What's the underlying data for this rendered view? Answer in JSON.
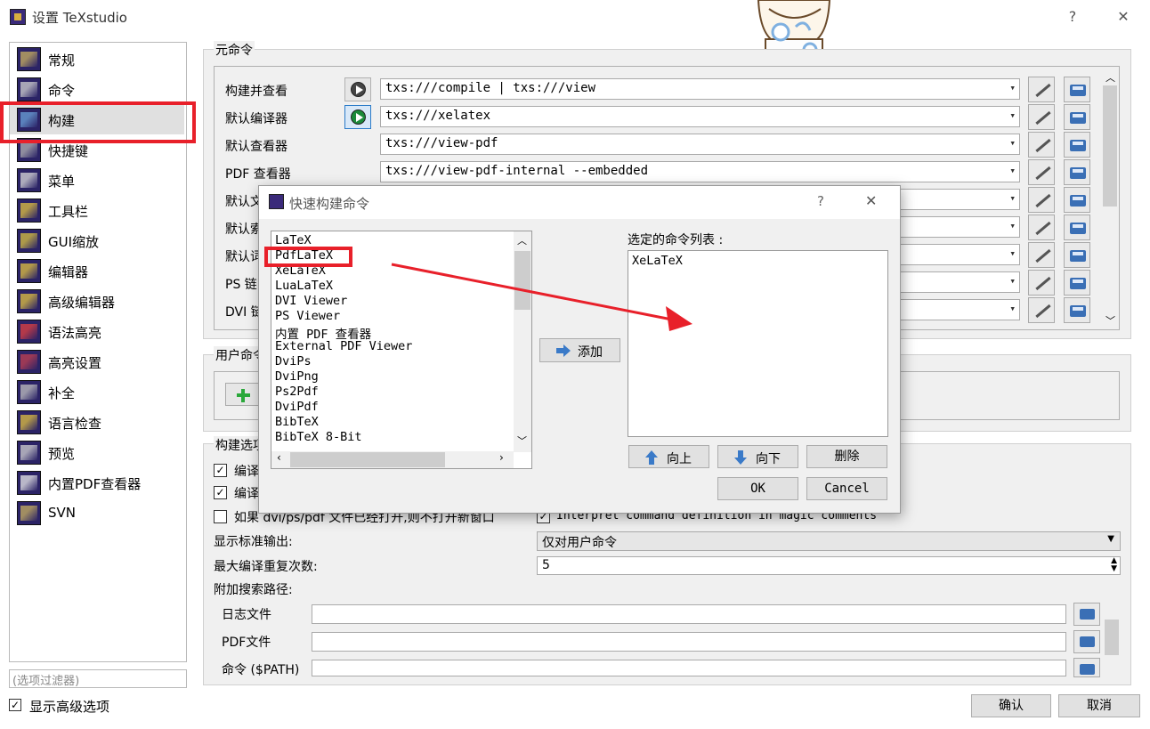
{
  "window": {
    "title": "设置 TeXstudio",
    "help_label": "?",
    "close_label": "✕"
  },
  "sidebar": {
    "items": [
      {
        "label": "常规",
        "icon": "txs-icon"
      },
      {
        "label": "命令",
        "icon": "latex-icon"
      },
      {
        "label": "构建",
        "icon": "build-icon",
        "selected": true
      },
      {
        "label": "快捷键",
        "icon": "keyboard-icon"
      },
      {
        "label": "菜单",
        "icon": "menu-icon"
      },
      {
        "label": "工具栏",
        "icon": "toolbar-icon"
      },
      {
        "label": "GUI缩放",
        "icon": "gui-scale-icon"
      },
      {
        "label": "编辑器",
        "icon": "editor-icon"
      },
      {
        "label": "高级编辑器",
        "icon": "advanced-editor-icon"
      },
      {
        "label": "语法高亮",
        "icon": "syntax-highlight-icon"
      },
      {
        "label": "高亮设置",
        "icon": "highlight-settings-icon"
      },
      {
        "label": "补全",
        "icon": "completion-icon"
      },
      {
        "label": "语言检查",
        "icon": "language-check-icon"
      },
      {
        "label": "预览",
        "icon": "preview-icon"
      },
      {
        "label": "内置PDF查看器",
        "icon": "pdf-viewer-icon"
      },
      {
        "label": "SVN",
        "icon": "svn-icon"
      }
    ],
    "filter_placeholder": "(选项过滤器)",
    "show_advanced_label": "显示高级选项",
    "show_advanced_checked": true
  },
  "meta_commands": {
    "title": "元命令",
    "rows": [
      {
        "label": "构建并查看",
        "value": "txs:///compile | txs:///view"
      },
      {
        "label": "默认编译器",
        "value": "txs:///xelatex"
      },
      {
        "label": "默认查看器",
        "value": "txs:///view-pdf"
      },
      {
        "label": "PDF 查看器",
        "value": "txs:///view-pdf-internal --embedded"
      },
      {
        "label": "默认文",
        "value": ""
      },
      {
        "label": "默认索",
        "value": ""
      },
      {
        "label": "默认词",
        "value": ""
      },
      {
        "label": "PS 链",
        "value": ""
      },
      {
        "label": "DVI 链",
        "value": ""
      }
    ]
  },
  "user_commands": {
    "title": "用户命令"
  },
  "build_options": {
    "title": "构建选项",
    "opt1_label": "编译",
    "opt2_label": "编译",
    "opt3_label": "如果 dvi/ps/pdf 文件已经打开,则不打开新窗口",
    "magic_label": "Interpret command definition in magic comments",
    "stdout_label": "显示标准输出:",
    "stdout_value": "仅对用户命令",
    "repeat_label": "最大编译重复次数:",
    "repeat_value": "5",
    "search_paths_label": "附加搜索路径:",
    "log_label": "日志文件",
    "pdf_label": "PDF文件",
    "path_label": "命令 ($PATH)"
  },
  "footer": {
    "ok_label": "确认",
    "cancel_label": "取消"
  },
  "dialog": {
    "title": "快速构建命令",
    "help_label": "?",
    "close_label": "✕",
    "commands": [
      "LaTeX",
      "PdfLaTeX",
      "XeLaTeX",
      "LuaLaTeX",
      "DVI Viewer",
      "PS Viewer",
      "内置 PDF 查看器",
      "External PDF Viewer",
      "DviPs",
      "DviPng",
      "Ps2Pdf",
      "DviPdf",
      "BibTeX",
      "BibTeX 8-Bit"
    ],
    "add_label": "添加",
    "selected_label": "选定的命令列表 :",
    "selected": [
      "XeLaTeX"
    ],
    "up_label": "向上",
    "down_label": "向下",
    "delete_label": "删除",
    "ok_label": "OK",
    "cancel_label": "Cancel"
  },
  "colors": {
    "highlight": "#e8202a",
    "icon_bg": "#2b2366"
  }
}
